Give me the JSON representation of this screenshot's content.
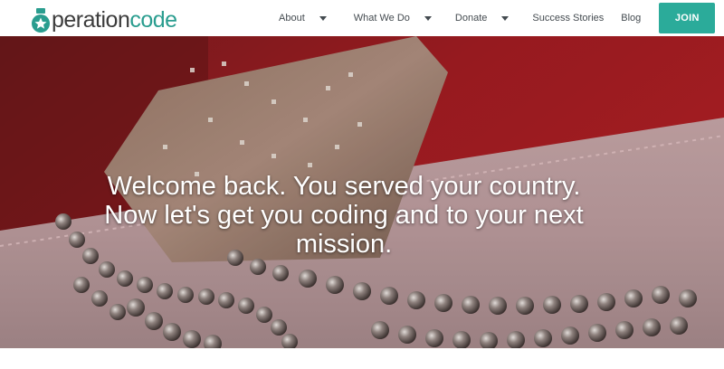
{
  "brand": {
    "logo_prefix": "O",
    "logo_mid": "peration",
    "logo_suffix": "code",
    "accent_color": "#2bab9a"
  },
  "nav": {
    "items": [
      {
        "label": "About",
        "has_dropdown": true
      },
      {
        "label": "What We Do",
        "has_dropdown": true
      },
      {
        "label": "Donate",
        "has_dropdown": true
      },
      {
        "label": "Success Stories",
        "has_dropdown": false
      },
      {
        "label": "Blog",
        "has_dropdown": false
      }
    ],
    "join_label": "JOIN"
  },
  "hero": {
    "lines": [
      "Welcome back. You served your country.",
      "Now let's get you coding and to your next",
      "mission."
    ]
  },
  "icons": [
    "medal-star-icon",
    "chevron-down-icon"
  ]
}
